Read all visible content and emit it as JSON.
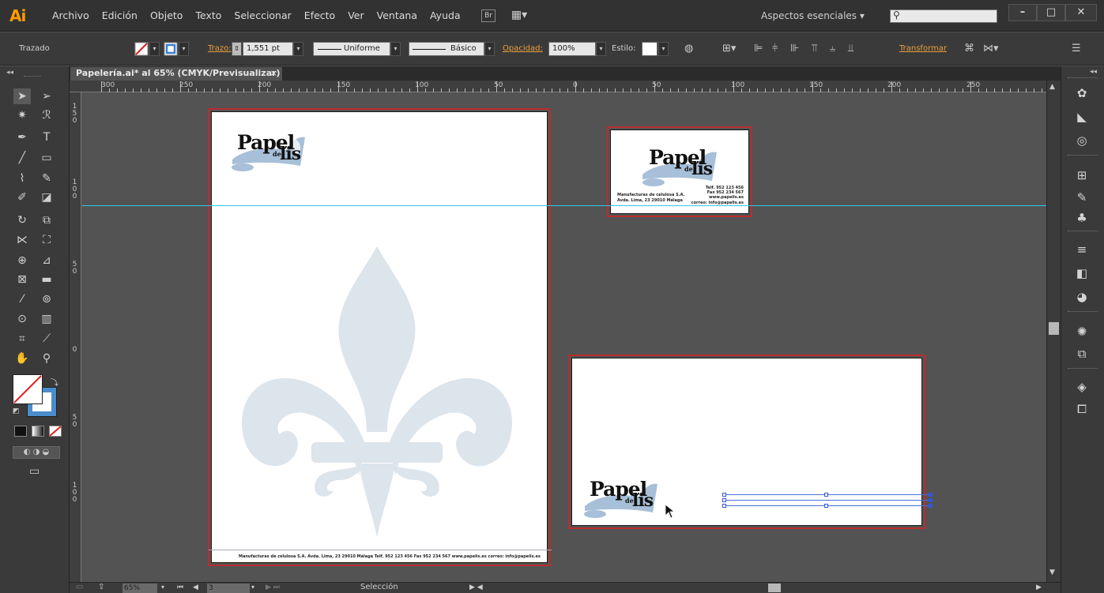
{
  "app": {
    "logo": "Ai"
  },
  "menu": [
    "Archivo",
    "Edición",
    "Objeto",
    "Texto",
    "Seleccionar",
    "Efecto",
    "Ver",
    "Ventana",
    "Ayuda"
  ],
  "menubar": {
    "bridge_label": "Br",
    "workspace": "Aspectos esenciales",
    "search_placeholder": ""
  },
  "controlbar": {
    "selection_type": "Trazado",
    "stroke_label": "Trazo:",
    "stroke_value": "1,551 pt",
    "profile": "Uniforme",
    "brush": "Básico",
    "opacity_label": "Opacidad:",
    "opacity_value": "100%",
    "style_label": "Estilo:",
    "transform_label": "Transformar"
  },
  "document": {
    "tab_title": "Papelería.ai* al 65% (CMYK/Previsualizar)",
    "close": "×"
  },
  "ruler": {
    "h_ticks": [
      "300",
      "250",
      "200",
      "150",
      "100",
      "50",
      "0",
      "50",
      "100",
      "150",
      "200",
      "250"
    ],
    "v_ticks": [
      "1\n5\n0",
      "1\n0\n0",
      "5\n0",
      "0",
      "5\n0",
      "1\n0\n0"
    ]
  },
  "logo": {
    "word": "Papel",
    "de": "de",
    "lis": "lis"
  },
  "letterhead": {
    "footer": "Manufacturas de celulosa S.A.  Avda. Lima, 23  29010 Málaga  Telf. 952 123 456 Fax 952 234 567 www.papelis.es correo: info@papelis.es"
  },
  "business_card": {
    "left_line1": "Manufacturas de celulosa S.A.",
    "left_line2": "Avda. Lima, 23  29010 Málaga",
    "right_line1": "Telf. 952 123 456",
    "right_line2": "Fax 952 234 567",
    "right_line3": "www.papelis.es",
    "right_line4": "correo: info@papelis.es"
  },
  "statusbar": {
    "zoom": "65%",
    "artboard": "3",
    "tool": "Selección"
  },
  "colors": {
    "accent": "#b82d2d",
    "guide": "#33c8e6",
    "logo_blue": "#a7bfd8",
    "watermark": "#dce4ec"
  }
}
